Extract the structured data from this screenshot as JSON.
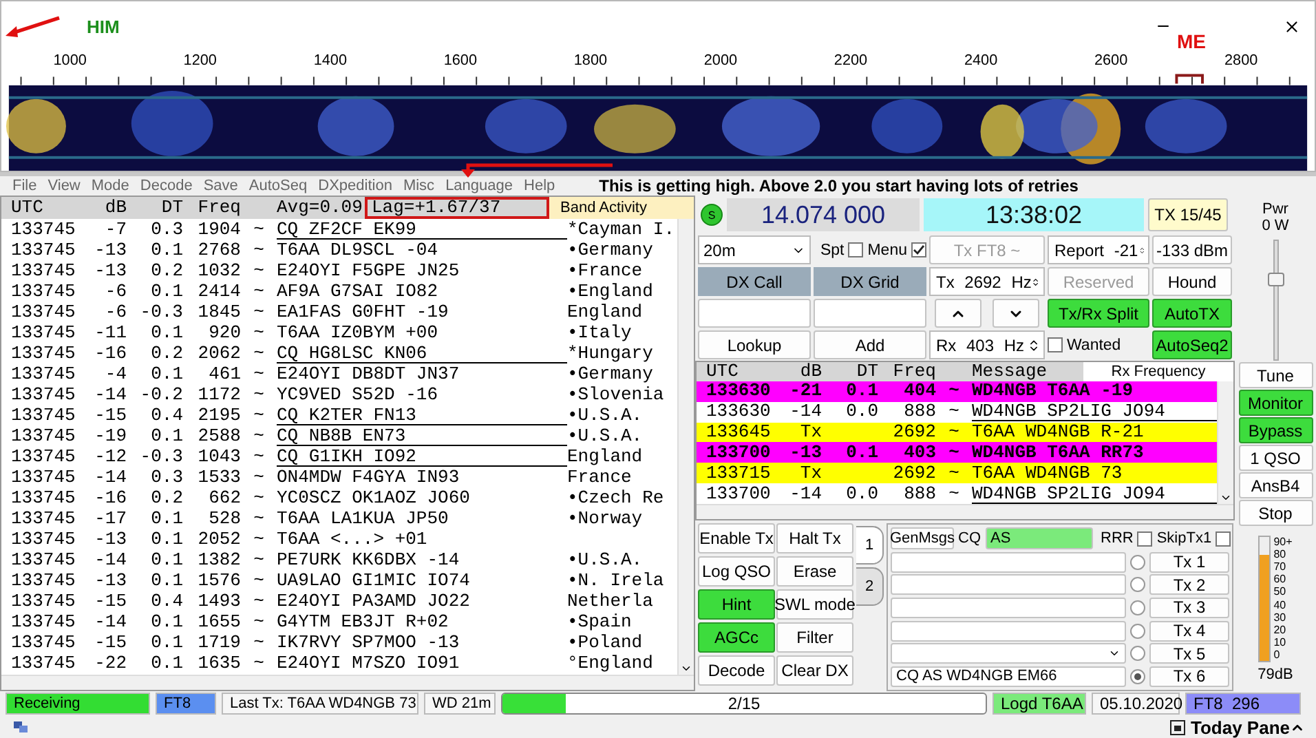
{
  "title_bar": {
    "left_label": "HIM",
    "right_label": "ME"
  },
  "scale": {
    "labels": [
      "1000",
      "1200",
      "1400",
      "1600",
      "1800",
      "2000",
      "2200",
      "2400",
      "2600",
      "2800"
    ]
  },
  "menu": [
    "File",
    "View",
    "Mode",
    "Decode",
    "Save",
    "AutoSeq",
    "DXpedition",
    "Misc",
    "Language",
    "Help"
  ],
  "note": "This is getting high. Above 2.0 you start having lots of retries",
  "band_activity": {
    "title": "Band Activity",
    "columns": [
      "UTC",
      "dB",
      "DT",
      "Freq"
    ],
    "avg": "Avg=0.09",
    "lag": "Lag=+1.67/37",
    "rows": [
      {
        "utc": "133745",
        "db": "-7",
        "dt": "0.3",
        "freq": "1904",
        "sep": "~",
        "message": "CQ ZF2CF EK99",
        "country": "*Cayman I.",
        "underlined": true
      },
      {
        "utc": "133745",
        "db": "-13",
        "dt": "0.1",
        "freq": "2768",
        "sep": "~",
        "message": "T6AA DL9SCL -04",
        "country": "•Germany",
        "underlined": false
      },
      {
        "utc": "133745",
        "db": "-13",
        "dt": "0.2",
        "freq": "1032",
        "sep": "~",
        "message": "E24OYI F5GPE JN25",
        "country": "•France",
        "underlined": false
      },
      {
        "utc": "133745",
        "db": "-6",
        "dt": "0.1",
        "freq": "2414",
        "sep": "~",
        "message": "AF9A G7SAI IO82",
        "country": "•England",
        "underlined": false
      },
      {
        "utc": "133745",
        "db": "-6",
        "dt": "-0.3",
        "freq": "1845",
        "sep": "~",
        "message": "EA1FAS G0FHT -19",
        "country": "England",
        "underlined": false
      },
      {
        "utc": "133745",
        "db": "-11",
        "dt": "0.1",
        "freq": "920",
        "sep": "~",
        "message": "T6AA IZ0BYM +00",
        "country": "•Italy",
        "underlined": false
      },
      {
        "utc": "133745",
        "db": "-16",
        "dt": "0.2",
        "freq": "2062",
        "sep": "~",
        "message": "CQ HG8LSC KN06",
        "country": "*Hungary",
        "underlined": true
      },
      {
        "utc": "133745",
        "db": "-4",
        "dt": "0.1",
        "freq": "461",
        "sep": "~",
        "message": "E24OYI DB8DT JN37",
        "country": "•Germany",
        "underlined": false
      },
      {
        "utc": "133745",
        "db": "-14",
        "dt": "-0.2",
        "freq": "1172",
        "sep": "~",
        "message": "YC9VED S52D -16",
        "country": "•Slovenia",
        "underlined": false
      },
      {
        "utc": "133745",
        "db": "-15",
        "dt": "0.4",
        "freq": "2195",
        "sep": "~",
        "message": "CQ K2TER FN13",
        "country": "•U.S.A.",
        "underlined": true
      },
      {
        "utc": "133745",
        "db": "-19",
        "dt": "0.1",
        "freq": "2588",
        "sep": "~",
        "message": "CQ NB8B EN73",
        "country": "•U.S.A.",
        "underlined": true
      },
      {
        "utc": "133745",
        "db": "-12",
        "dt": "-0.3",
        "freq": "1043",
        "sep": "~",
        "message": "CQ G1IKH IO92",
        "country": "England",
        "underlined": true
      },
      {
        "utc": "133745",
        "db": "-14",
        "dt": "0.3",
        "freq": "1533",
        "sep": "~",
        "message": "ON4MDW F4GYA IN93",
        "country": "France",
        "underlined": false
      },
      {
        "utc": "133745",
        "db": "-16",
        "dt": "0.2",
        "freq": "662",
        "sep": "~",
        "message": "YC0SCZ OK1AOZ JO60",
        "country": "•Czech Re",
        "underlined": false
      },
      {
        "utc": "133745",
        "db": "-17",
        "dt": "0.1",
        "freq": "528",
        "sep": "~",
        "message": "T6AA LA1KUA JP50",
        "country": "•Norway",
        "underlined": false
      },
      {
        "utc": "133745",
        "db": "-13",
        "dt": "0.1",
        "freq": "2052",
        "sep": "~",
        "message": "T6AA <...> +01",
        "underlined": false
      },
      {
        "utc": "133745",
        "db": "-14",
        "dt": "0.1",
        "freq": "1382",
        "sep": "~",
        "message": "PE7URK KK6DBX -14",
        "country": "•U.S.A.",
        "underlined": false
      },
      {
        "utc": "133745",
        "db": "-13",
        "dt": "0.1",
        "freq": "1576",
        "sep": "~",
        "message": "UA9LAO GI1MIC IO74",
        "country": "•N. Irela",
        "underlined": false
      },
      {
        "utc": "133745",
        "db": "-15",
        "dt": "0.4",
        "freq": "1493",
        "sep": "~",
        "message": "E24OYI PA3AMD JO22",
        "country": "Netherla",
        "underlined": false
      },
      {
        "utc": "133745",
        "db": "-14",
        "dt": "0.1",
        "freq": "1655",
        "sep": "~",
        "message": "G4YTM EB3JT R+02",
        "country": "•Spain",
        "underlined": false
      },
      {
        "utc": "133745",
        "db": "-15",
        "dt": "0.1",
        "freq": "1719",
        "sep": "~",
        "message": "IK7RVY SP7MOO -13",
        "country": "•Poland",
        "underlined": false
      },
      {
        "utc": "133745",
        "db": "-22",
        "dt": "0.1",
        "freq": "1635",
        "sep": "~",
        "message": "E24OYI M7SZO IO91",
        "country": "°England",
        "underlined": false
      }
    ]
  },
  "top": {
    "indicator": "S",
    "dial": "14.074 000",
    "clock": "13:38:02",
    "tx_period": "TX 15/45"
  },
  "controls": {
    "band": "20m",
    "spot": {
      "label": "Spt",
      "checked": false
    },
    "menu": {
      "label": "Menu",
      "checked": true
    },
    "dx_call": "DX Call",
    "dx_grid": "DX Grid",
    "lookup": "Lookup",
    "add": "Add",
    "tx_mode": {
      "label": "Tx FT8 ~",
      "disabled": true
    },
    "tx_freq": "Tx 2692 Hz",
    "rx_freq": "Rx 403 Hz",
    "report": "Report -21",
    "dbm": "-133 dBm",
    "reserved": {
      "label": "Reserved",
      "disabled": true
    },
    "hound": {
      "label": "Hound",
      "on": false
    },
    "split": {
      "label": "Tx/Rx Split",
      "on": true
    },
    "auto_tx": {
      "label": "AutoTX",
      "on": true
    },
    "wanted": {
      "label": "Wanted",
      "checked": false
    },
    "auto_seq": {
      "label": "AutoSeq2",
      "on": true
    }
  },
  "rx_frequency": {
    "title": "Rx Frequency",
    "columns": [
      "UTC",
      "dB",
      "DT",
      "Freq",
      "Message"
    ],
    "rows": [
      {
        "kind": "to_me",
        "utc": "133630",
        "db": "-21",
        "dt": "0.1",
        "freq": "404",
        "sep": "~",
        "message": "WD4NGB T6AA -19",
        "underlined": false
      },
      {
        "kind": "other",
        "utc": "133630",
        "db": "-14",
        "dt": "0.0",
        "freq": "888",
        "sep": "~",
        "message": "WD4NGB SP2LIG JO94",
        "underlined": true
      },
      {
        "kind": "tx",
        "utc": "133645",
        "db": "Tx",
        "freq": "2692",
        "sep": "~",
        "message": "T6AA WD4NGB R-21",
        "underlined": false
      },
      {
        "kind": "to_me",
        "utc": "133700",
        "db": "-13",
        "dt": "0.1",
        "freq": "403",
        "sep": "~",
        "message": "WD4NGB T6AA RR73",
        "underlined": false
      },
      {
        "kind": "tx",
        "utc": "133715",
        "db": "Tx",
        "freq": "2692",
        "sep": "~",
        "message": "T6AA WD4NGB 73",
        "underlined": false
      },
      {
        "kind": "other",
        "utc": "133700",
        "db": "-14",
        "dt": "0.0",
        "freq": "888",
        "sep": "~",
        "message": "WD4NGB SP2LIG JO94",
        "underlined": true
      }
    ]
  },
  "actions": [
    {
      "label": "Enable Tx",
      "on": false
    },
    {
      "label": "Halt Tx",
      "on": false
    },
    {
      "label": "Log QSO",
      "on": false
    },
    {
      "label": "Erase",
      "on": false
    },
    {
      "label": "Hint",
      "on": true
    },
    {
      "label": "SWL mode",
      "on": false
    },
    {
      "label": "AGCc",
      "on": true
    },
    {
      "label": "Filter",
      "on": false
    },
    {
      "label": "Decode",
      "on": false
    },
    {
      "label": "Clear DX",
      "on": false
    }
  ],
  "tabs": [
    {
      "label": "1",
      "selected": true
    },
    {
      "label": "2",
      "selected": false
    }
  ],
  "messages": {
    "gen_msgs": "GenMsgs",
    "cq_label": "CQ",
    "cq_value": "AS",
    "rrr": {
      "label": "RRR",
      "checked": false
    },
    "skip_tx1": {
      "label": "SkipTx1",
      "checked": false
    },
    "rows": [
      {
        "button": "Tx 1",
        "selected": false
      },
      {
        "button": "Tx 2",
        "selected": false
      },
      {
        "button": "Tx 3",
        "selected": false
      },
      {
        "button": "Tx 4",
        "selected": false
      },
      {
        "button": "Tx 5",
        "selected": false,
        "combo": true
      },
      {
        "button": "Tx 6",
        "selected": true,
        "value": "CQ AS WD4NGB EM66"
      }
    ]
  },
  "power": {
    "label": "Pwr",
    "value": "0 W",
    "level": 0.7
  },
  "side_buttons": [
    {
      "label": "Tune",
      "on": false
    },
    {
      "label": "Monitor",
      "on": true
    },
    {
      "label": "Bypass",
      "on": true
    },
    {
      "label": "1 QSO",
      "on": false
    },
    {
      "label": "AnsB4",
      "on": false
    },
    {
      "label": "Stop",
      "on": false
    }
  ],
  "meter": {
    "ticks": [
      "90+",
      "80",
      "70",
      "60",
      "50",
      "40",
      "30",
      "20",
      "10",
      "0"
    ],
    "level": 0.85,
    "reading": "79dB"
  },
  "status_bar": {
    "state": "Receiving",
    "mode": "FT8",
    "last_tx": "Last Tx: T6AA WD4NGB 73",
    "wd": "WD 21m",
    "progress": {
      "level": 0.13,
      "text": "2/15"
    },
    "logged": "Logd T6AA",
    "date": "05.10.2020",
    "mode_count": "FT8  296"
  },
  "footer": {
    "label": "Today Pane"
  }
}
